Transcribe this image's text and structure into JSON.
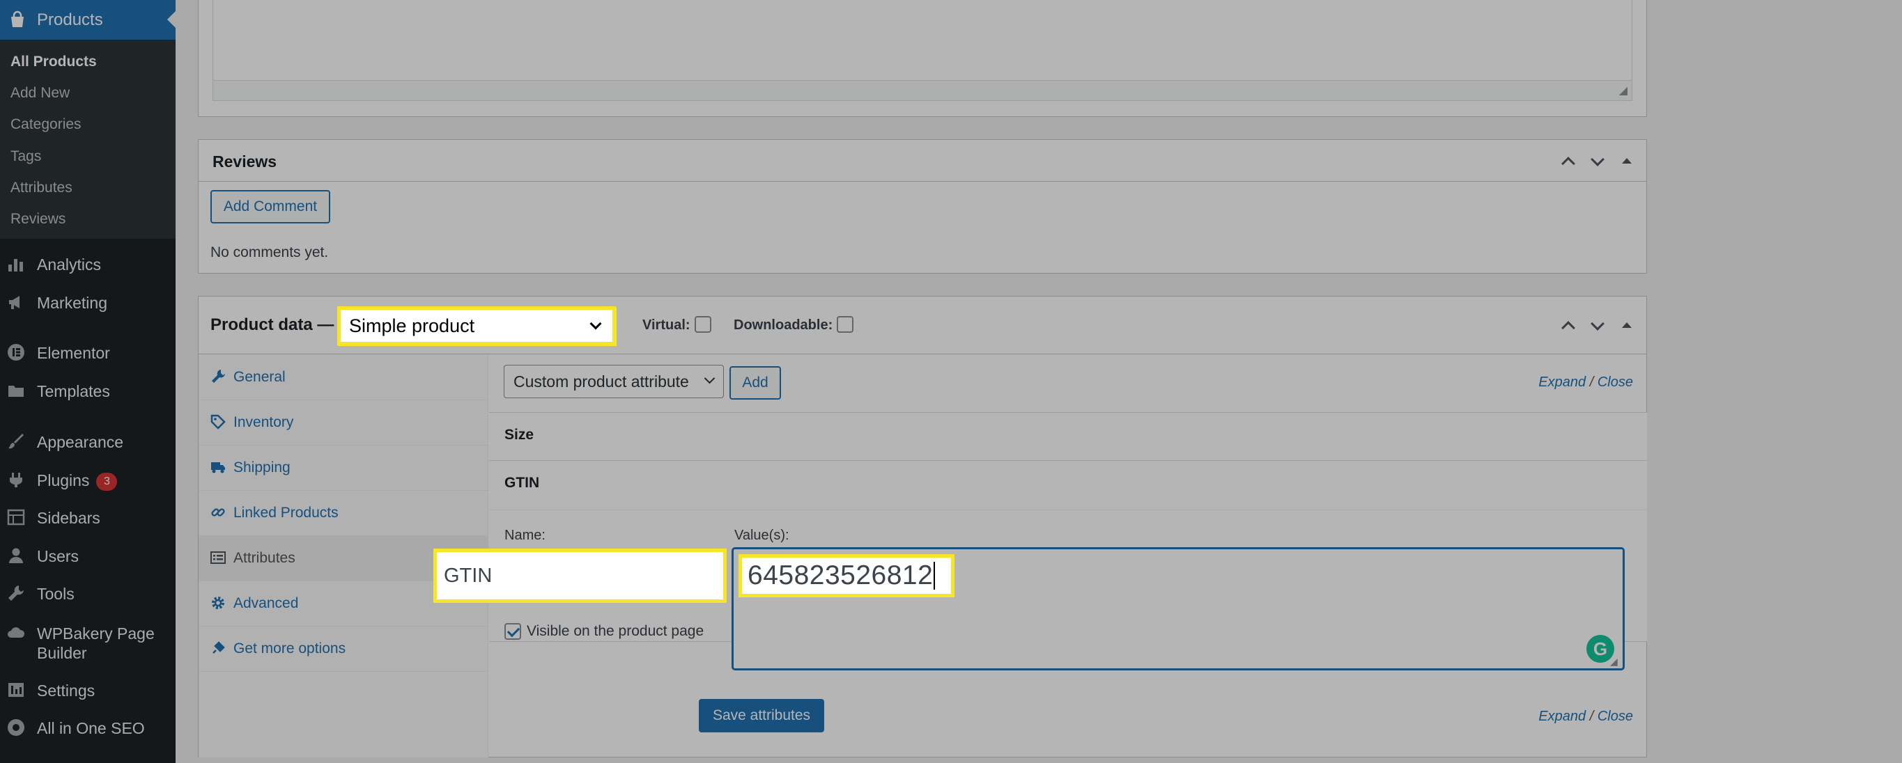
{
  "sidebar": {
    "products_label": "Products",
    "submenu": [
      "All Products",
      "Add New",
      "Categories",
      "Tags",
      "Attributes",
      "Reviews"
    ],
    "items": [
      {
        "label": "Analytics",
        "icon": "bar-chart-icon"
      },
      {
        "label": "Marketing",
        "icon": "megaphone-icon"
      },
      {
        "label": "Elementor",
        "icon": "elementor-icon"
      },
      {
        "label": "Templates",
        "icon": "folder-icon"
      },
      {
        "label": "Appearance",
        "icon": "paintbrush-icon"
      },
      {
        "label": "Plugins",
        "icon": "plug-icon",
        "badge": "3"
      },
      {
        "label": "Sidebars",
        "icon": "table-icon"
      },
      {
        "label": "Users",
        "icon": "user-icon"
      },
      {
        "label": "Tools",
        "icon": "wrench-icon"
      },
      {
        "label": "WPBakery Page",
        "label2": "Builder",
        "icon": "cloud-icon"
      },
      {
        "label": "Settings",
        "icon": "sliders-icon"
      },
      {
        "label": "All in One SEO",
        "icon": "seo-gear-icon"
      }
    ]
  },
  "reviews": {
    "title": "Reviews",
    "add_comment": "Add Comment",
    "no_comments": "No comments yet."
  },
  "product_data": {
    "title": "Product data —",
    "type_select": "Simple product",
    "virtual_label": "Virtual:",
    "downloadable_label": "Downloadable:",
    "tabs": [
      {
        "label": "General",
        "icon": "wrench-icon"
      },
      {
        "label": "Inventory",
        "icon": "tag-icon"
      },
      {
        "label": "Shipping",
        "icon": "truck-icon"
      },
      {
        "label": "Linked Products",
        "icon": "link-icon"
      },
      {
        "label": "Attributes",
        "icon": "list-icon"
      },
      {
        "label": "Advanced",
        "icon": "gear-icon"
      },
      {
        "label": "Get more options",
        "icon": "plug-icon"
      }
    ],
    "attributes": {
      "attribute_select": "Custom product attribute",
      "add_label": "Add",
      "expand": "Expand",
      "separator": " / ",
      "close": "Close",
      "rows": [
        "Size",
        "GTIN"
      ],
      "name_label": "Name:",
      "values_label": "Value(s):",
      "name_value": "GTIN",
      "value_text": "645823526812",
      "visible_label": "Visible on the product page",
      "save_label": "Save attributes"
    }
  },
  "colors": {
    "accent": "#2271b1",
    "highlight": "#f7e628",
    "sidebar_bg": "#1d2327",
    "badge": "#d63638"
  }
}
